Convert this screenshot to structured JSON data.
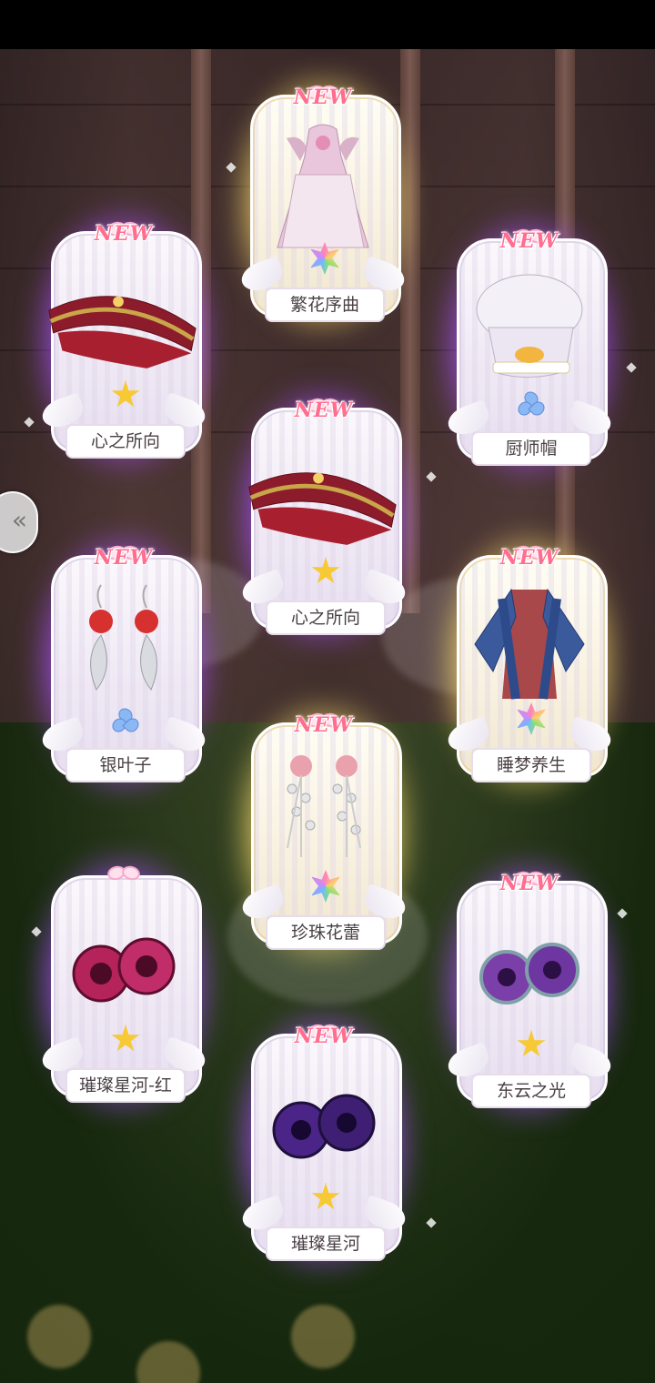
{
  "new_label": "NEW",
  "side_button_glyph": "«",
  "items": [
    {
      "name": "繁花序曲",
      "frame": "gold",
      "quality": "rainbow",
      "art": "dress",
      "is_new": true
    },
    {
      "name": "心之所向",
      "frame": "purple",
      "quality": "star",
      "art": "hat",
      "is_new": true
    },
    {
      "name": "厨师帽",
      "frame": "purple",
      "quality": "drops",
      "art": "chef-hat",
      "is_new": true
    },
    {
      "name": "心之所向",
      "frame": "purple",
      "quality": "star",
      "art": "hat",
      "is_new": true
    },
    {
      "name": "银叶子",
      "frame": "purple",
      "quality": "drops",
      "art": "earrings",
      "is_new": true
    },
    {
      "name": "睡梦养生",
      "frame": "gold",
      "quality": "rainbow",
      "art": "robe",
      "is_new": true
    },
    {
      "name": "珍珠花蕾",
      "frame": "gold",
      "quality": "rainbow",
      "art": "pearl-pins",
      "is_new": true
    },
    {
      "name": "璀璨星河-红",
      "frame": "purple",
      "quality": "star",
      "art": "eyes-red",
      "is_new": false
    },
    {
      "name": "东云之光",
      "frame": "purple",
      "quality": "star",
      "art": "eyes-violet",
      "is_new": true
    },
    {
      "name": "璀璨星河",
      "frame": "purple",
      "quality": "star",
      "art": "eyes-purple",
      "is_new": true
    }
  ],
  "colors": {
    "purple_glow": "#aa50ff",
    "gold_glow": "#ffe16e",
    "new_text": "#ff6d8f"
  }
}
